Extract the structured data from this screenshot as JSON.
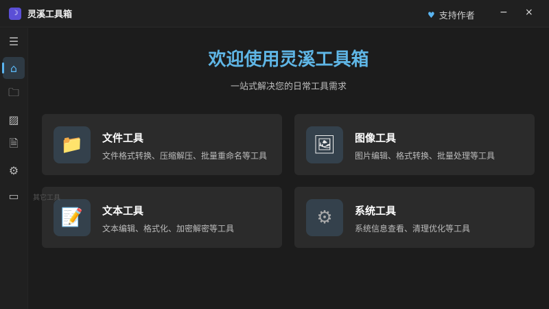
{
  "app": {
    "title": "灵溪工具箱",
    "support_label": "支持作者",
    "minimize": "−",
    "close": "×"
  },
  "sidebar": {
    "items": [
      {
        "icon": "menu-icon",
        "glyph": "☰"
      },
      {
        "icon": "home-icon",
        "glyph": "⌂",
        "active": true
      },
      {
        "icon": "folder-icon",
        "glyph": "🗀"
      },
      {
        "icon": "image-icon",
        "glyph": "▨"
      },
      {
        "icon": "document-icon",
        "glyph": "🗎"
      },
      {
        "icon": "gear-icon",
        "glyph": "⚙"
      },
      {
        "icon": "other-tools-icon",
        "glyph": "▭"
      }
    ],
    "tooltip": "其它工具"
  },
  "main": {
    "title": "欢迎使用灵溪工具箱",
    "subtitle": "一站式解决您的日常工具需求",
    "cards": [
      {
        "title": "文件工具",
        "desc": "文件格式转换、压缩解压、批量重命名等工具",
        "glyph": "📁"
      },
      {
        "title": "图像工具",
        "desc": "图片编辑、格式转换、批量处理等工具",
        "glyph": "🖼"
      },
      {
        "title": "文本工具",
        "desc": "文本编辑、格式化、加密解密等工具",
        "glyph": "📝"
      },
      {
        "title": "系统工具",
        "desc": "系统信息查看、清理优化等工具",
        "glyph": "⚙"
      }
    ]
  }
}
